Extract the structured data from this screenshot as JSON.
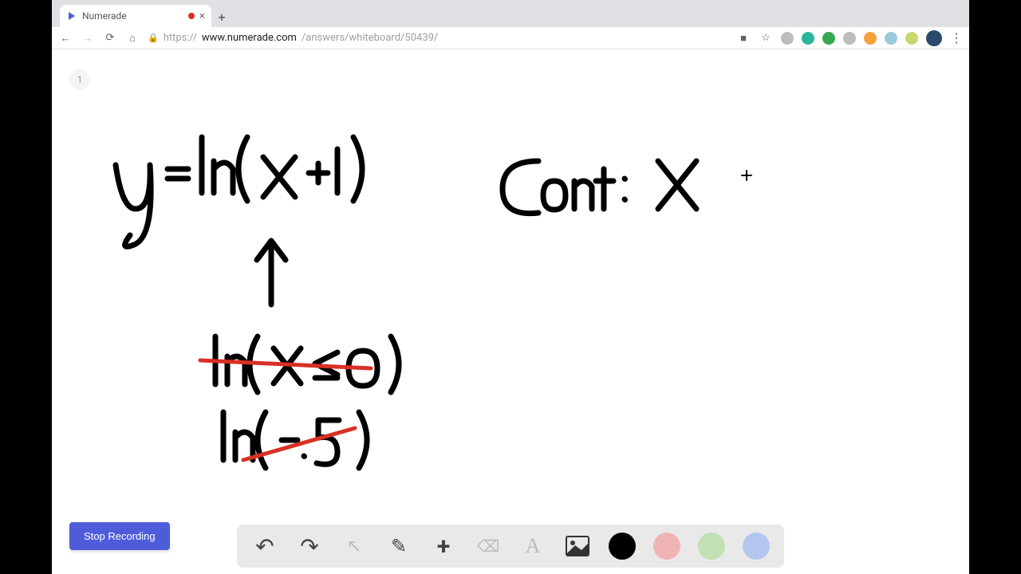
{
  "browser": {
    "tab_title": "Numerade",
    "url_scheme": "https://",
    "url_host": "www.numerade.com",
    "url_path": "/answers/whiteboard/50439/",
    "close_glyph": "×",
    "newtab_glyph": "+",
    "back_glyph": "←",
    "forward_glyph": "→",
    "reload_glyph": "⟳",
    "home_glyph": "⌂",
    "lock_glyph": "🔒",
    "cam_glyph": "■",
    "star_glyph": "☆",
    "kebab_glyph": "⋮"
  },
  "page": {
    "badge": "1",
    "stop_label": "Stop Recording"
  },
  "whiteboard": {
    "expr_main": "y = ln(x+1)",
    "expr_cont_label": "Cont:",
    "expr_cont_var": "X",
    "expr_struck1": "ln(x ≤ 0)",
    "expr_struck2": "ln(-.5)"
  },
  "toolbar": {
    "undo_glyph": "↶",
    "redo_glyph": "↷",
    "pointer_glyph": "↖",
    "pencil_glyph": "✎",
    "plus_glyph": "+",
    "eraser_glyph": "⌫",
    "text_glyph": "A",
    "image_glyph": "🖼"
  },
  "colors": {
    "ext1": "#bdbdbd",
    "ext2": "#2bb69b",
    "ext3": "#34a853",
    "ext4": "#bdbdbd",
    "ext5": "#f6a23c",
    "ext6": "#9ccad8",
    "ext7": "#c9d86e",
    "swatch_black": "#000000",
    "swatch_red": "#f0b3b3",
    "swatch_green": "#c2e0b4",
    "swatch_blue": "#b3c6ef"
  }
}
